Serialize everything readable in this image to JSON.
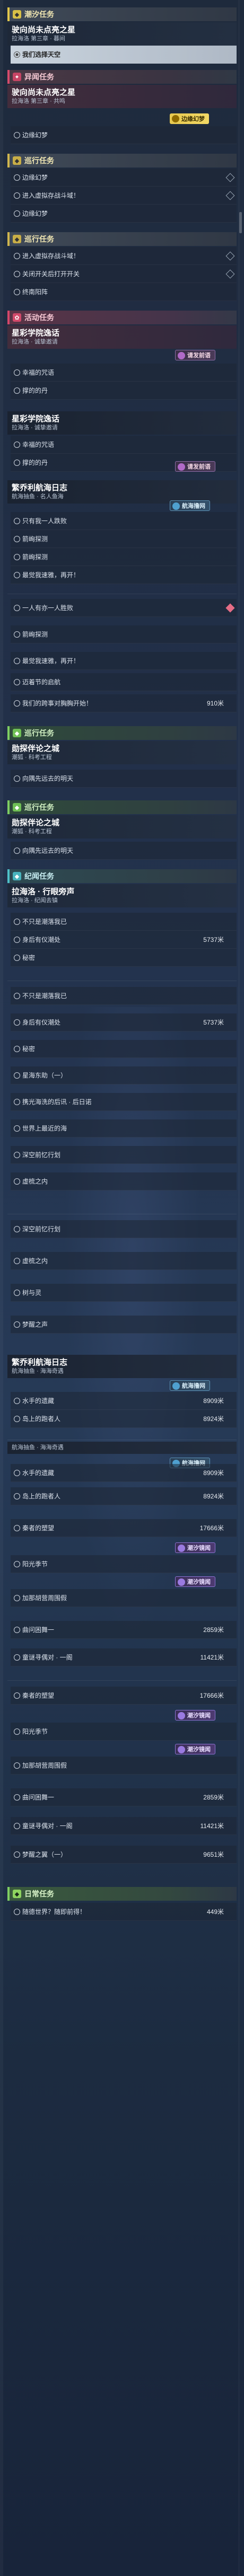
{
  "sections": {
    "main": "潮汐任务",
    "abnormal": "异闻任务",
    "tour1": "巡行任务",
    "tour2": "巡行任务",
    "activity": "活动任务",
    "guardian": "巡行任务",
    "discovery": "纪闻任务",
    "daily": "日常任务"
  },
  "quests": {
    "q1": {
      "title": "驶向尚未点亮之星",
      "sub": "拉海洛 第三章 · 暮间"
    },
    "q1_row": "我们选择天空",
    "q2": {
      "title": "驶向尚未点亮之星",
      "sub": "拉海洛 第三章 · 共鸣"
    },
    "q2_rows": [
      "边缘幻梦"
    ],
    "tour_rows": [
      "边缘幻梦",
      "进入虚拟存战斗域！",
      "边缘幻梦"
    ],
    "tour2_rows": [
      "进入虚拟存战斗域！",
      "关闭开关后打开开关",
      "终南阳阵"
    ],
    "q3": {
      "title": "星彩学院逸话",
      "sub": "拉海洛 · 诚挚邀请"
    },
    "q3_rows": [
      "幸福的咒语",
      "撑的的丹"
    ],
    "q4": {
      "title": "星彩学院逸话",
      "sub": "拉海洛 · 诚挚邀请"
    },
    "q4_rows": [
      "幸福的咒语",
      "撑的的丹"
    ],
    "q5": {
      "title": "繁乔利航海日志",
      "sub": "航海抽鱼 · 名人鱼海"
    },
    "q5_rows": [
      "只有我一人跌败",
      "箭峋探测",
      "箭峋探测",
      "最觉我速雅，再开！"
    ],
    "q5_rows2": [
      "一人有亦一人胜败",
      "箭峋探测",
      "最觉我速雅，再开！",
      "迈着节的启航",
      "我们的跨事对胸胸开始！"
    ],
    "q5_dist": "910米",
    "q6": {
      "title": "勋探伴论之城",
      "sub": "潮狐 · 科考工程"
    },
    "q6_row": "向隅先远去的明天",
    "q7": {
      "title": "勋探伴论之城",
      "sub": "潮狐 · 科考工程"
    },
    "q7_row": "向隅先远去的明天",
    "q8": {
      "title": "拉海洛 · 行眼旁声",
      "sub": "拉海洛 · 纪闻去镇"
    },
    "q8_rows": [
      "不只是潮落我已",
      "身后有仪潮处",
      "秘密"
    ],
    "q8_dist": "5737米",
    "q8_rows2": [
      "不只是潮落我已",
      "身后有仪潮处",
      "秘密",
      "星海东助（一）",
      "携光海洗的后讯 · 后日诺",
      "世界上最近的海",
      "深空前忆行划",
      "虚梳之内"
    ],
    "q8_dist2": "5737米",
    "q8_rows3": [
      "深空前忆行划",
      "虚梳之内",
      "树与灵",
      "梦醒之声"
    ],
    "q9": {
      "title": "繁乔利航海日志",
      "sub": "航海抽鱼 · 海海奇遇"
    },
    "q9_rows": [
      "水手的遗藏",
      "岛上的跑者人"
    ],
    "q9_dist": [
      "8909米",
      "8924米"
    ],
    "q9_rows2": [
      "水手的遗藏",
      "岛上的跑者人",
      "秦者的塑望",
      "阳光季节",
      "加那胡营周围假",
      "曲问困舞一",
      "童谜寻偶对 · 一阁"
    ],
    "q9_dist2": [
      "8909米",
      "8924米",
      "17666米",
      "",
      "",
      "2859米",
      "11421米"
    ],
    "q9_rows3": [
      "秦者的塑望",
      "阳光季节",
      "加那胡营周围假",
      "曲问困舞一",
      "童谜寻偶对 · 一阁",
      "梦醒之翼（一）"
    ],
    "q9_dist3": [
      "17666米",
      "",
      "",
      "2859米",
      "11421米",
      "9651米"
    ],
    "daily_row": "随德世界？随即前得！",
    "daily_dist": "449米"
  },
  "badges": {
    "edge_dream": "边缘幻梦",
    "invite": "请发前语",
    "voyage": "航海撸网",
    "tide": "潮汐镜闻"
  },
  "colors": {
    "accent_gold": "#e1c74c",
    "accent_pink": "#d5476a",
    "accent_green": "#7fcf62",
    "accent_teal": "#4fc1c9"
  }
}
